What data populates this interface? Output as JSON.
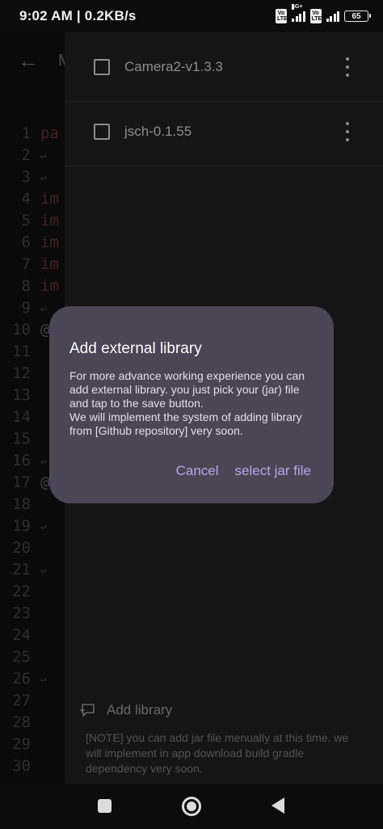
{
  "status_bar": {
    "time_speed": "9:02 AM | 0.2KB/s",
    "volte1": "Vo LTE",
    "network": "4G+",
    "volte2": "Vo LTE",
    "battery": "65"
  },
  "editor": {
    "title": "M",
    "line_numbers": [
      "1",
      "2",
      "3",
      "4",
      "5",
      "6",
      "7",
      "8",
      "9",
      "10",
      "11",
      "12",
      "13",
      "14",
      "15",
      "16",
      "17",
      "18",
      "19",
      "20",
      "21",
      "22",
      "23",
      "24",
      "25",
      "26",
      "27",
      "28",
      "29",
      "30"
    ],
    "code_fragments": [
      "pa",
      "↵",
      "↵",
      "im",
      "im",
      "im",
      "im",
      "im",
      "↵",
      "@D",
      "",
      "",
      "",
      "",
      "",
      "↵",
      "@",
      "",
      "↵",
      "",
      "↵",
      "",
      "",
      "",
      "",
      "↵",
      "",
      "",
      "",
      ""
    ]
  },
  "drawer": {
    "libraries": [
      {
        "name": "Camera2-v1.3.3"
      },
      {
        "name": "jsch-0.1.55"
      }
    ],
    "add_library_label": "Add library",
    "note": "[NOTE] you can add jar file menually at this time. we will implement in app download  build gradle dependency very soon."
  },
  "dialog": {
    "title": "Add external library",
    "body_line1": "For more advance working experience you can add external library.  you just pick your (jar) file and tap to the save button.",
    "body_line2": "We will implement the system of adding library from [Github repository] very soon.",
    "cancel_label": "Cancel",
    "confirm_label": "select jar file"
  }
}
